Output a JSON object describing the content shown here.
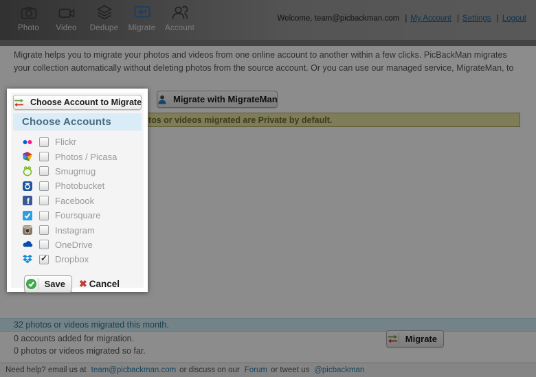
{
  "header": {
    "nav_items": [
      {
        "label": "Photo"
      },
      {
        "label": "Video"
      },
      {
        "label": "Dedupe"
      },
      {
        "label": "Migrate",
        "active": true
      },
      {
        "label": "Account"
      }
    ],
    "welcome_text": "Welcome,",
    "user_email": "team@picbackman.com",
    "links": [
      {
        "label": "My Account"
      },
      {
        "label": "Settings"
      },
      {
        "label": "Logout"
      }
    ]
  },
  "intro": {
    "line1": "Migrate helps you to migrate your photos and videos from one online account to another within a few clicks. PicBackMan migrates",
    "line2": "your collection automatically without deleting photos from the source account. Or you can use our managed service, MigrateMan, to"
  },
  "toolbar": {
    "choose_account_button": "Choose Account to Migrate",
    "migrateman_button": "Migrate with MigrateMan"
  },
  "note_bar": {
    "text": "photos or videos migrated are Private by default."
  },
  "popup": {
    "title": "Choose Accounts",
    "accounts": [
      {
        "name": "Flickr",
        "checked": false
      },
      {
        "name": "Photos / Picasa",
        "checked": false
      },
      {
        "name": "Smugmug",
        "checked": false
      },
      {
        "name": "Photobucket",
        "checked": false
      },
      {
        "name": "Facebook",
        "checked": false
      },
      {
        "name": "Foursquare",
        "checked": false
      },
      {
        "name": "Instagram",
        "checked": false
      },
      {
        "name": "OneDrive",
        "checked": false
      },
      {
        "name": "Dropbox",
        "checked": true
      }
    ],
    "save_button": "Save",
    "cancel_button": "Cancel"
  },
  "stats": {
    "monthly": "32 photos or videos migrated this month.",
    "accounts_added": "0 accounts added for migration.",
    "migrated_so_far": "0 photos or videos migrated so far.",
    "migrate_button": "Migrate"
  },
  "footer": {
    "help_prefix": "Need help? email us at",
    "email_link": "team@picbackman.com",
    "discuss_text": "or discuss on our",
    "forum_link": "Forum",
    "tweet_text": "or tweet us",
    "twitter_link": "@picbackman"
  },
  "colors": {
    "accent_blue": "#2d6fc2",
    "link_blue": "#1d5e8f",
    "note_bg": "#e7e3a0",
    "info_bar_bg": "#d3eef7",
    "save_green": "#3dae49",
    "cancel_red": "#c43c35"
  }
}
